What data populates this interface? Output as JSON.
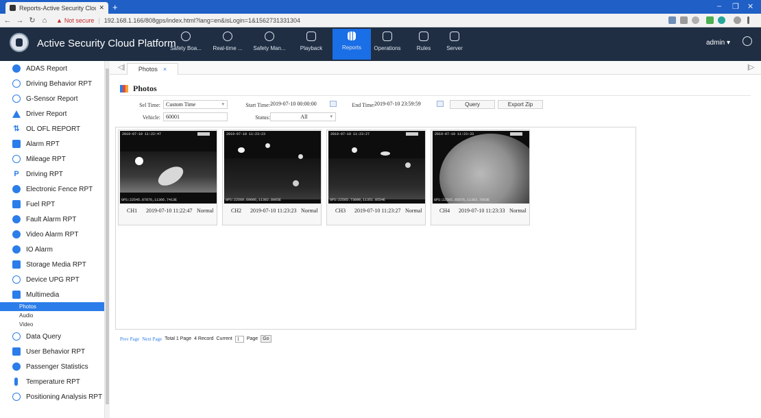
{
  "browser": {
    "tab_title": "Reports-Active Security Cloud",
    "new_tab": "+",
    "not_secure": "Not secure",
    "url": "192.168.1.166/808gps/index.html?lang=en&isLogin=1&1562731331304",
    "win_min": "–",
    "win_max": "❐",
    "win_close": "✕"
  },
  "app": {
    "title": "Active Security Cloud Platform",
    "nav": [
      {
        "label": "Safety Boa...",
        "icon": "shield-icon"
      },
      {
        "label": "Real-time ...",
        "icon": "location-pin-icon"
      },
      {
        "label": "Safety Man...",
        "icon": "play-circle-icon"
      },
      {
        "label": "Playback",
        "icon": "playback-icon"
      },
      {
        "label": "Reports",
        "icon": "bar-chart-icon"
      },
      {
        "label": "Operations",
        "icon": "operations-icon"
      },
      {
        "label": "Rules",
        "icon": "rules-icon"
      },
      {
        "label": "Server",
        "icon": "server-icon"
      }
    ],
    "user": "admin ▾"
  },
  "sidebar": {
    "items": [
      {
        "label": "ADAS Report",
        "icon": "shield-icon"
      },
      {
        "label": "Driving Behavior RPT",
        "icon": "steering-wheel-icon"
      },
      {
        "label": "G-Sensor Report",
        "icon": "gauge-icon"
      },
      {
        "label": "Driver Report",
        "icon": "driver-icon"
      },
      {
        "label": "OL OFL REPORT",
        "icon": "updown-arrows-icon"
      },
      {
        "label": "Alarm RPT",
        "icon": "alarm-icon"
      },
      {
        "label": "Mileage RPT",
        "icon": "mileage-icon"
      },
      {
        "label": "Driving RPT",
        "icon": "parking-icon"
      },
      {
        "label": "Electronic Fence RPT",
        "icon": "fence-pin-icon"
      },
      {
        "label": "Fuel RPT",
        "icon": "fuel-icon"
      },
      {
        "label": "Fault Alarm RPT",
        "icon": "fault-shield-icon"
      },
      {
        "label": "Video Alarm RPT",
        "icon": "video-alarm-icon"
      },
      {
        "label": "IO Alarm",
        "icon": "io-alarm-icon"
      },
      {
        "label": "Storage Media RPT",
        "icon": "storage-icon"
      },
      {
        "label": "Device UPG RPT",
        "icon": "device-upgrade-icon"
      },
      {
        "label": "Multimedia",
        "icon": "multimedia-icon"
      }
    ],
    "sub_items": [
      "Photos",
      "Audio",
      "Video"
    ],
    "bottom_items": [
      {
        "label": "Data Query",
        "icon": "data-query-icon"
      },
      {
        "label": "User Behavior RPT",
        "icon": "user-behavior-icon"
      },
      {
        "label": "Passenger Statistics",
        "icon": "passengers-icon"
      },
      {
        "label": "Temperature RPT",
        "icon": "thermometer-icon"
      },
      {
        "label": "Positioning Analysis RPT",
        "icon": "positioning-icon"
      }
    ]
  },
  "content": {
    "tab_label": "Photos",
    "tab_close": "×",
    "title": "Photos",
    "filters": {
      "sel_time_label": "Sel Time:",
      "sel_time_value": "Custom Time",
      "start_time_label": "Start Time:",
      "start_time_value": "2019-07-10 00:00:00",
      "end_time_label": "End Time:",
      "end_time_value": "2019-07-10 23:59:59",
      "query_button": "Query",
      "export_button": "Export Zip",
      "vehicle_label": "Vehicle:",
      "vehicle_value": "60001",
      "status_label": "Status:",
      "status_value": "All"
    },
    "photos": [
      {
        "channel": "CH1",
        "time": "2019-07-10 11:22:47",
        "status": "Normal",
        "osd_top": "2019-07-10 11:22:47",
        "osd_bottom": "GPS:22545.87876,11366.7413E"
      },
      {
        "channel": "CH2",
        "time": "2019-07-10 11:23:23",
        "status": "Normal",
        "osd_top": "2019-07-10 11:23:23",
        "osd_bottom": "GPS:22560.69006,11382.8065E"
      },
      {
        "channel": "CH3",
        "time": "2019-07-10 11:23:27",
        "status": "Normal",
        "osd_top": "2019-07-10 11:23:27",
        "osd_bottom": "GPS:22565.73890,11351.8554E"
      },
      {
        "channel": "CH4",
        "time": "2019-07-10 11:23:33",
        "status": "Normal",
        "osd_top": "2019-07-10 11:23:33",
        "osd_bottom": "GPS:22565.85876,11383.7663E"
      }
    ],
    "pager": {
      "prev": "Prev Page",
      "next": "Next Page",
      "total": "Total 1 Page",
      "records": "4 Record",
      "current_label": "Current",
      "current_value": "1",
      "page_label": "Page",
      "go": "Go"
    }
  },
  "colors": {
    "header_bg": "#1f2e43",
    "accent": "#2b7de9",
    "browser_bar": "#1f5fc6"
  }
}
